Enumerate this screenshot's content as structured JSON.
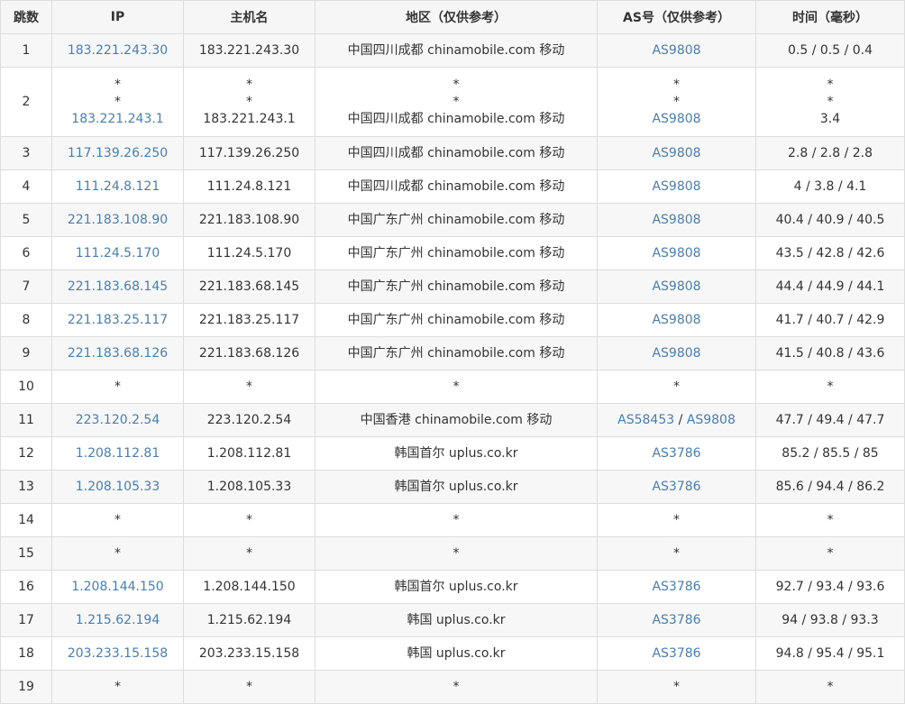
{
  "columns": {
    "hop": "跳数",
    "ip": "IP",
    "hostname": "主机名",
    "region": "地区（仅供参考）",
    "asn": "AS号（仅供参考）",
    "time": "时间（毫秒）"
  },
  "colors": {
    "link": "#4a7eb0",
    "text": "#333333",
    "header_bg": "#f6f6f6",
    "row_stripe": "#f7f7f7",
    "border": "#dddddd"
  },
  "rows": [
    {
      "hop": "1",
      "ip": "183.221.243.30",
      "host": "183.221.243.30",
      "region": "中国四川成都 chinamobile.com 移动",
      "as1": "AS9808",
      "as2": "",
      "time": "0.5 / 0.5 / 0.4"
    },
    {
      "hop": "2",
      "ip_l1": "*",
      "ip_l2": "*",
      "ip_l3": "183.221.243.1",
      "host_l1": "*",
      "host_l2": "*",
      "host_l3": "183.221.243.1",
      "region_l1": "*",
      "region_l2": "*",
      "region_l3": "中国四川成都 chinamobile.com 移动",
      "as_l1": "*",
      "as_l2": "*",
      "as_l3": "AS9808",
      "time_l1": "*",
      "time_l2": "*",
      "time_l3": "3.4"
    },
    {
      "hop": "3",
      "ip": "117.139.26.250",
      "host": "117.139.26.250",
      "region": "中国四川成都 chinamobile.com 移动",
      "as1": "AS9808",
      "as2": "",
      "time": "2.8 / 2.8 / 2.8"
    },
    {
      "hop": "4",
      "ip": "111.24.8.121",
      "host": "111.24.8.121",
      "region": "中国四川成都 chinamobile.com 移动",
      "as1": "AS9808",
      "as2": "",
      "time": "4 / 3.8 / 4.1"
    },
    {
      "hop": "5",
      "ip": "221.183.108.90",
      "host": "221.183.108.90",
      "region": "中国广东广州 chinamobile.com 移动",
      "as1": "AS9808",
      "as2": "",
      "time": "40.4 / 40.9 / 40.5"
    },
    {
      "hop": "6",
      "ip": "111.24.5.170",
      "host": "111.24.5.170",
      "region": "中国广东广州 chinamobile.com 移动",
      "as1": "AS9808",
      "as2": "",
      "time": "43.5 / 42.8 / 42.6"
    },
    {
      "hop": "7",
      "ip": "221.183.68.145",
      "host": "221.183.68.145",
      "region": "中国广东广州 chinamobile.com 移动",
      "as1": "AS9808",
      "as2": "",
      "time": "44.4 / 44.9 / 44.1"
    },
    {
      "hop": "8",
      "ip": "221.183.25.117",
      "host": "221.183.25.117",
      "region": "中国广东广州 chinamobile.com 移动",
      "as1": "AS9808",
      "as2": "",
      "time": "41.7 / 40.7 / 42.9"
    },
    {
      "hop": "9",
      "ip": "221.183.68.126",
      "host": "221.183.68.126",
      "region": "中国广东广州 chinamobile.com 移动",
      "as1": "AS9808",
      "as2": "",
      "time": "41.5 / 40.8 / 43.6"
    },
    {
      "hop": "10",
      "ip": "*",
      "host": "*",
      "region": "*",
      "as1": "*",
      "as2": "",
      "time": "*"
    },
    {
      "hop": "11",
      "ip": "223.120.2.54",
      "host": "223.120.2.54",
      "region": "中国香港 chinamobile.com 移动",
      "as1": "AS58453",
      "as_sep": " / ",
      "as2": "AS9808",
      "time": "47.7 / 49.4 / 47.7"
    },
    {
      "hop": "12",
      "ip": "1.208.112.81",
      "host": "1.208.112.81",
      "region": "韩国首尔 uplus.co.kr",
      "as1": "AS3786",
      "as2": "",
      "time": "85.2 / 85.5 / 85"
    },
    {
      "hop": "13",
      "ip": "1.208.105.33",
      "host": "1.208.105.33",
      "region": "韩国首尔 uplus.co.kr",
      "as1": "AS3786",
      "as2": "",
      "time": "85.6 / 94.4 / 86.2"
    },
    {
      "hop": "14",
      "ip": "*",
      "host": "*",
      "region": "*",
      "as1": "*",
      "as2": "",
      "time": "*"
    },
    {
      "hop": "15",
      "ip": "*",
      "host": "*",
      "region": "*",
      "as1": "*",
      "as2": "",
      "time": "*"
    },
    {
      "hop": "16",
      "ip": "1.208.144.150",
      "host": "1.208.144.150",
      "region": "韩国首尔 uplus.co.kr",
      "as1": "AS3786",
      "as2": "",
      "time": "92.7 / 93.4 / 93.6"
    },
    {
      "hop": "17",
      "ip": "1.215.62.194",
      "host": "1.215.62.194",
      "region": "韩国 uplus.co.kr",
      "as1": "AS3786",
      "as2": "",
      "time": "94 / 93.8 / 93.3"
    },
    {
      "hop": "18",
      "ip": "203.233.15.158",
      "host": "203.233.15.158",
      "region": "韩国 uplus.co.kr",
      "as1": "AS3786",
      "as2": "",
      "time": "94.8 / 95.4 / 95.1"
    },
    {
      "hop": "19",
      "ip": "*",
      "host": "*",
      "region": "*",
      "as1": "*",
      "as2": "",
      "time": "*"
    }
  ]
}
